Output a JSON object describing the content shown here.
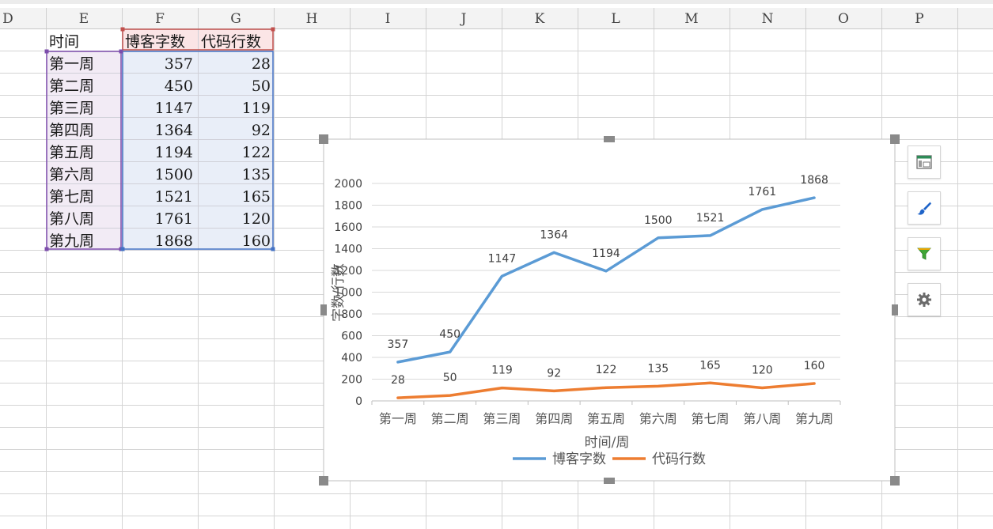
{
  "spreadsheet": {
    "columns": [
      "D",
      "E",
      "F",
      "G",
      "H",
      "I",
      "J",
      "K",
      "L",
      "M",
      "N",
      "O",
      "P"
    ],
    "table": {
      "headers": [
        "时间",
        "博客字数",
        "代码行数"
      ],
      "rows": [
        [
          "第一周",
          "357",
          "28"
        ],
        [
          "第二周",
          "450",
          "50"
        ],
        [
          "第三周",
          "1147",
          "119"
        ],
        [
          "第四周",
          "1364",
          "92"
        ],
        [
          "第五周",
          "1194",
          "122"
        ],
        [
          "第六周",
          "1500",
          "135"
        ],
        [
          "第七周",
          "1521",
          "165"
        ],
        [
          "第八周",
          "1761",
          "120"
        ],
        [
          "第九周",
          "1868",
          "160"
        ]
      ]
    }
  },
  "chart_data": {
    "type": "line",
    "categories": [
      "第一周",
      "第二周",
      "第三周",
      "第四周",
      "第五周",
      "第六周",
      "第七周",
      "第八周",
      "第九周"
    ],
    "series": [
      {
        "name": "博客字数",
        "values": [
          357,
          450,
          1147,
          1364,
          1194,
          1500,
          1521,
          1761,
          1868
        ],
        "color": "#5b9bd5"
      },
      {
        "name": "代码行数",
        "values": [
          28,
          50,
          119,
          92,
          122,
          135,
          165,
          120,
          160
        ],
        "color": "#ed7d31"
      }
    ],
    "xlabel": "时间/周",
    "ylabel": "字数/行数",
    "ylim": [
      0,
      2000
    ],
    "yticks": [
      0,
      200,
      400,
      600,
      800,
      1000,
      1200,
      1400,
      1600,
      1800,
      2000
    ],
    "grid": true,
    "data_labels": true,
    "legend": "bottom"
  },
  "chart_tools": [
    {
      "name": "chart-elements-button",
      "icon": "chart-elements-icon"
    },
    {
      "name": "chart-styles-button",
      "icon": "paintbrush-icon"
    },
    {
      "name": "chart-filters-button",
      "icon": "filter-icon"
    },
    {
      "name": "chart-settings-button",
      "icon": "gear-icon"
    }
  ],
  "colors": {
    "gridline": "#d4d4d4",
    "header_bg": "#f3f3f3",
    "col_e_highlight": "#f2ebf5",
    "col_fg_highlight": "#e9eef8",
    "header_pink": "#fbe5e6",
    "selection_purple": "#7c4dab",
    "selection_red": "#c0504d",
    "selection_blue": "#4472c4"
  }
}
